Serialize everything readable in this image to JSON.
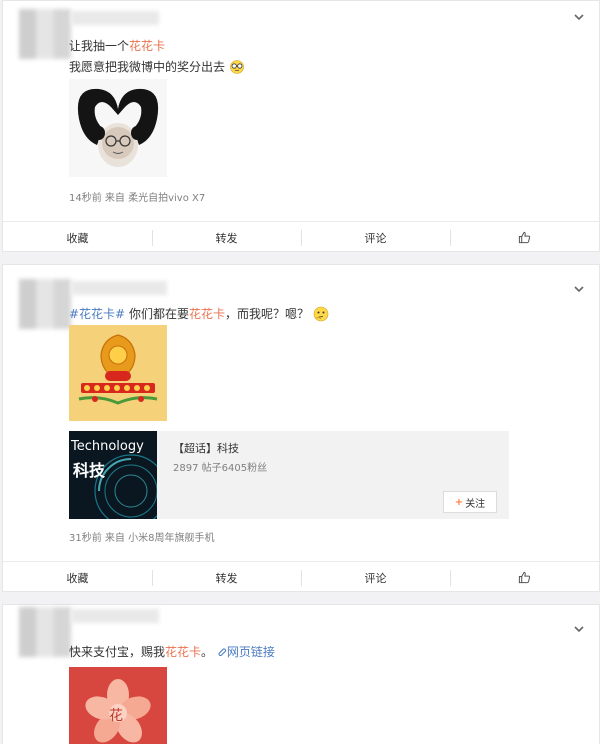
{
  "posts": [
    {
      "line1_prefix": "让我抽一个",
      "line1_keyword": "花花卡",
      "line2_text": "我愿意把我微博中的奖分出去",
      "meta": "14秒前 来自 柔光自拍vivo X7"
    },
    {
      "tag": "#花花卡#",
      "text_a": " 你们都在要",
      "keyword": "花花卡",
      "text_b": "，而我呢？嗯？",
      "topic": {
        "img_en": "Technology",
        "img_cn": "科技",
        "title": "【超话】科技",
        "stats": "2897 帖子6405粉丝",
        "follow_label": "关注"
      },
      "meta": "31秒前 来自 小米8周年旗舰手机"
    },
    {
      "text_a": "快来支付宝，赐我",
      "keyword": "花花卡",
      "text_b": "。",
      "link_label": "网页链接",
      "flower_char": "花"
    }
  ],
  "actions": {
    "favorite": "收藏",
    "repost": "转发",
    "comment": "评论"
  },
  "colors": {
    "keyword": "#eb7350",
    "link": "#4a7bc1",
    "meta": "#808080"
  }
}
